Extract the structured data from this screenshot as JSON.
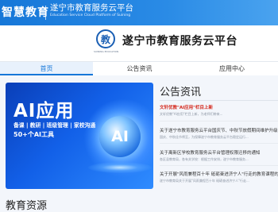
{
  "topbar": {
    "logo_text": "智慧教育",
    "title": "遂宁市教育服务云平台",
    "subtitle": "Education Service Cloud Platform of Suining"
  },
  "header": {
    "emblem_char": "教",
    "emblem_caption": "SUINING EDUCATION",
    "site_title": "遂宁市教育服务云平台"
  },
  "nav": {
    "items": [
      {
        "label": "首页",
        "active": true
      },
      {
        "label": "公告资讯",
        "active": false
      },
      {
        "label": "应用中心",
        "active": false
      }
    ]
  },
  "banner": {
    "title": "AI应用",
    "tags": "备课 | 教研 | 班级管理 | 家校沟通",
    "tool_count": "50+个AI工具",
    "orb_text": "AI"
  },
  "news": {
    "title": "公告资讯",
    "items": [
      {
        "head": "文轩优教\"AI应用\"栏目上新",
        "desc": "文轩优教\"AI应用\"栏目上新，为老师们带来...",
        "highlight": true
      },
      {
        "head": "关于遂宁市教育服务云平台国庆节、中秋节放假期间维护升级的通知",
        "desc": "国庆、中秋佳节将至，为保障遂宁市教育服务云平台稳定运行...",
        "highlight": false
      },
      {
        "head": "关于离新区学校教育服务云平台管理权限迁移的通知",
        "desc": "各区县教育局，各有关学校：根据工作安排，遂宁市教育服务...",
        "highlight": false
      },
      {
        "head": "关于开展\"风雨兼程百十年 砥砺奋进济宁人\"行走的教育课程的通知",
        "desc": "遂宁市教育局关于开展\"风雨兼程百十年 砥砺奋进济宁人\"行走...",
        "highlight": false
      }
    ]
  },
  "section": {
    "title": "教育资源"
  },
  "colors": {
    "topbar": "#1677d8",
    "accent": "#1677d8",
    "highlight_news": "#d4281c"
  }
}
